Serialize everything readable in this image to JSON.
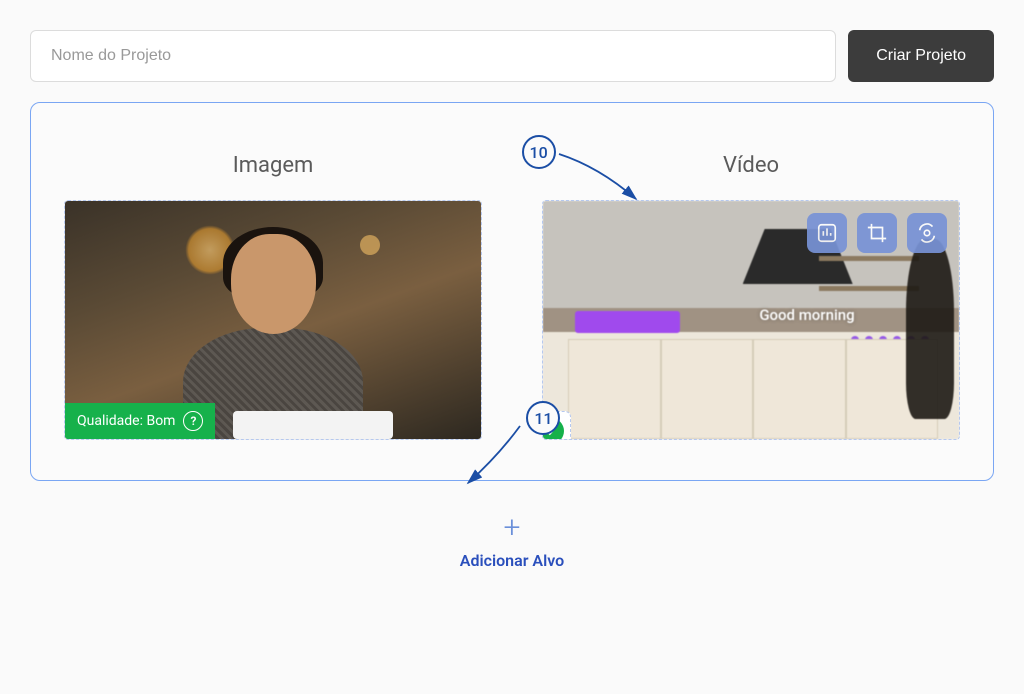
{
  "header": {
    "project_name_placeholder": "Nome do Projeto",
    "create_button_label": "Criar Projeto"
  },
  "targets": {
    "image_label": "Imagem",
    "video_label": "Vídeo",
    "quality_badge_text": "Qualidade: Bom",
    "video_overlay_text": "Good morning"
  },
  "annotations": {
    "a10": "10",
    "a11": "11"
  },
  "add_target": {
    "label": "Adicionar Alvo"
  },
  "icons": {
    "help": "?",
    "plus": "+"
  }
}
